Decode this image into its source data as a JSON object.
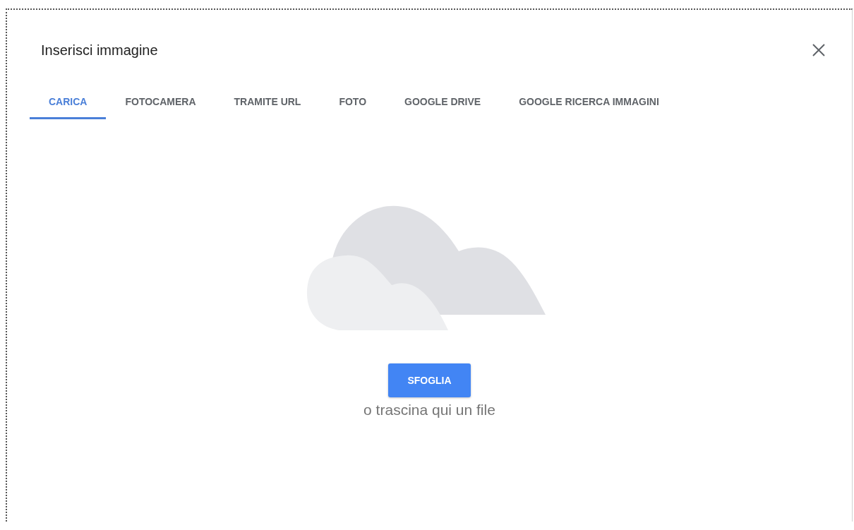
{
  "dialog": {
    "title": "Inserisci immagine",
    "close": true
  },
  "tabs": [
    {
      "label": "CARICA",
      "selected": true
    },
    {
      "label": "FOTOCAMERA",
      "selected": false
    },
    {
      "label": "TRAMITE URL",
      "selected": false
    },
    {
      "label": "FOTO",
      "selected": false
    },
    {
      "label": "GOOGLE DRIVE",
      "selected": false
    },
    {
      "label": "GOOGLE RICERCA IMMAGINI",
      "selected": false
    }
  ],
  "upload": {
    "button": "SFOGLIA",
    "hint": "o trascina qui un file"
  }
}
